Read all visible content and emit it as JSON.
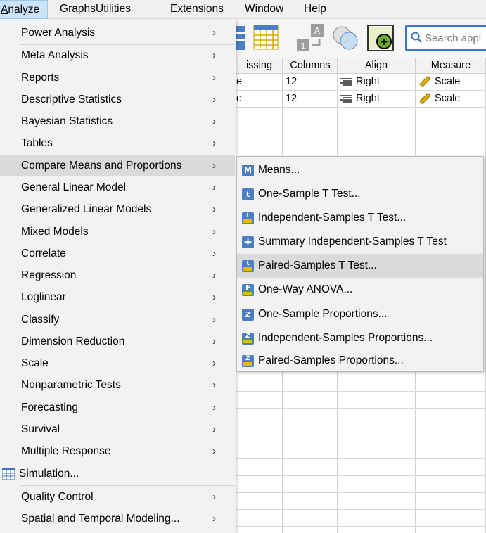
{
  "menubar": {
    "items": [
      {
        "label": "Analyze",
        "underline": "A",
        "active": true
      },
      {
        "label": "Graphs",
        "underline": "G"
      },
      {
        "label": "Utilities",
        "underline": "U"
      },
      {
        "label": "Extensions",
        "underline": "x"
      },
      {
        "label": "Window",
        "underline": "W"
      },
      {
        "label": "Help",
        "underline": "H"
      }
    ]
  },
  "search": {
    "placeholder": "Search appl"
  },
  "grid": {
    "headers": [
      "issing",
      "Columns",
      "Align",
      "Measure"
    ],
    "rows": [
      {
        "missing": "e",
        "columns": "12",
        "align": "Right",
        "measure": "Scale"
      },
      {
        "missing": "e",
        "columns": "12",
        "align": "Right",
        "measure": "Scale"
      }
    ]
  },
  "analyze_menu": {
    "items": [
      {
        "label": "Power Analysis",
        "submenu": true
      },
      {
        "label": "Meta Analysis",
        "submenu": true
      },
      {
        "label": "Reports",
        "submenu": true
      },
      {
        "label": "Descriptive Statistics",
        "submenu": true
      },
      {
        "label": "Bayesian Statistics",
        "submenu": true
      },
      {
        "label": "Tables",
        "submenu": true
      },
      {
        "label": "Compare Means and Proportions",
        "submenu": true,
        "highlighted": true
      },
      {
        "label": "General Linear Model",
        "submenu": true
      },
      {
        "label": "Generalized Linear Models",
        "submenu": true
      },
      {
        "label": "Mixed Models",
        "submenu": true
      },
      {
        "label": "Correlate",
        "submenu": true
      },
      {
        "label": "Regression",
        "submenu": true
      },
      {
        "label": "Loglinear",
        "submenu": true
      },
      {
        "label": "Classify",
        "submenu": true
      },
      {
        "label": "Dimension Reduction",
        "submenu": true
      },
      {
        "label": "Scale",
        "submenu": true
      },
      {
        "label": "Nonparametric Tests",
        "submenu": true
      },
      {
        "label": "Forecasting",
        "submenu": true
      },
      {
        "label": "Survival",
        "submenu": true
      },
      {
        "label": "Multiple Response",
        "submenu": true
      },
      {
        "label": "Simulation...",
        "submenu": false,
        "icon": "simulation-icon"
      },
      {
        "label": "Quality Control",
        "submenu": true
      },
      {
        "label": "Spatial and Temporal Modeling...",
        "submenu": true
      }
    ]
  },
  "compare_submenu": {
    "items": [
      {
        "label": "Means...",
        "icon": "means-icon",
        "glyph": "M"
      },
      {
        "label": "One-Sample T Test...",
        "icon": "t-test-icon",
        "glyph": "t"
      },
      {
        "label": "Independent-Samples T Test...",
        "icon": "independent-t-icon",
        "glyph": "t"
      },
      {
        "label": "Summary Independent-Samples T Test",
        "icon": "summary-t-icon",
        "glyph": "+"
      },
      {
        "label": "Paired-Samples T Test...",
        "icon": "paired-t-icon",
        "glyph": "t",
        "highlighted": true
      },
      {
        "label": "One-Way ANOVA...",
        "icon": "anova-icon",
        "glyph": "F"
      },
      {
        "label": "One-Sample Proportions...",
        "icon": "proportion-icon",
        "glyph": "Z"
      },
      {
        "label": "Independent-Samples Proportions...",
        "icon": "independent-proportion-icon",
        "glyph": "Z"
      },
      {
        "label": "Paired-Samples Proportions...",
        "icon": "paired-proportion-icon",
        "glyph": "Z"
      }
    ]
  },
  "colors": {
    "accent": "#3b73c6",
    "icon_blue": "#4a7fc1",
    "highlight": "#dadada",
    "menu_bg": "#f2f2f2"
  }
}
